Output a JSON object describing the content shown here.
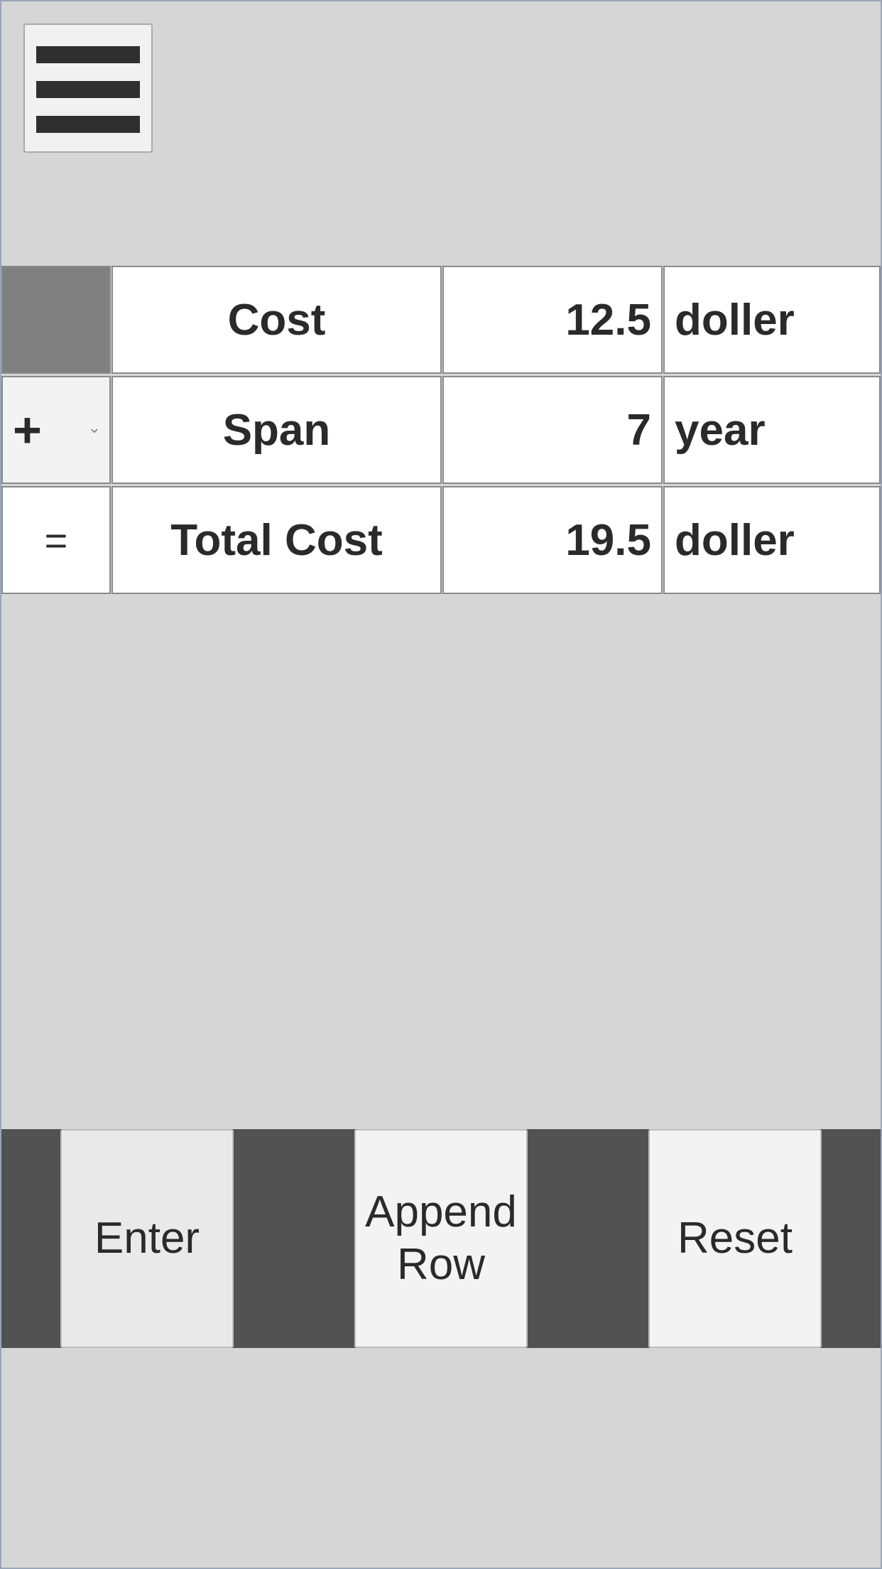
{
  "menu": {
    "icon": "hamburger-icon"
  },
  "rows": [
    {
      "operator": "",
      "name": "Cost",
      "value": "12.5",
      "unit": "doller"
    },
    {
      "operator": "+",
      "name": "Span",
      "value": "7",
      "unit": "year",
      "operator_dropdown": true
    },
    {
      "operator": "=",
      "name": "Total Cost",
      "value": "19.5",
      "unit": "doller"
    }
  ],
  "buttons": {
    "enter": "Enter",
    "append_row": "Append\nRow",
    "reset": "Reset"
  },
  "colors": {
    "background": "#d6d6d6",
    "button_bar": "#525252",
    "empty_operator_cell": "#808080",
    "text": "#2a2a2a"
  }
}
